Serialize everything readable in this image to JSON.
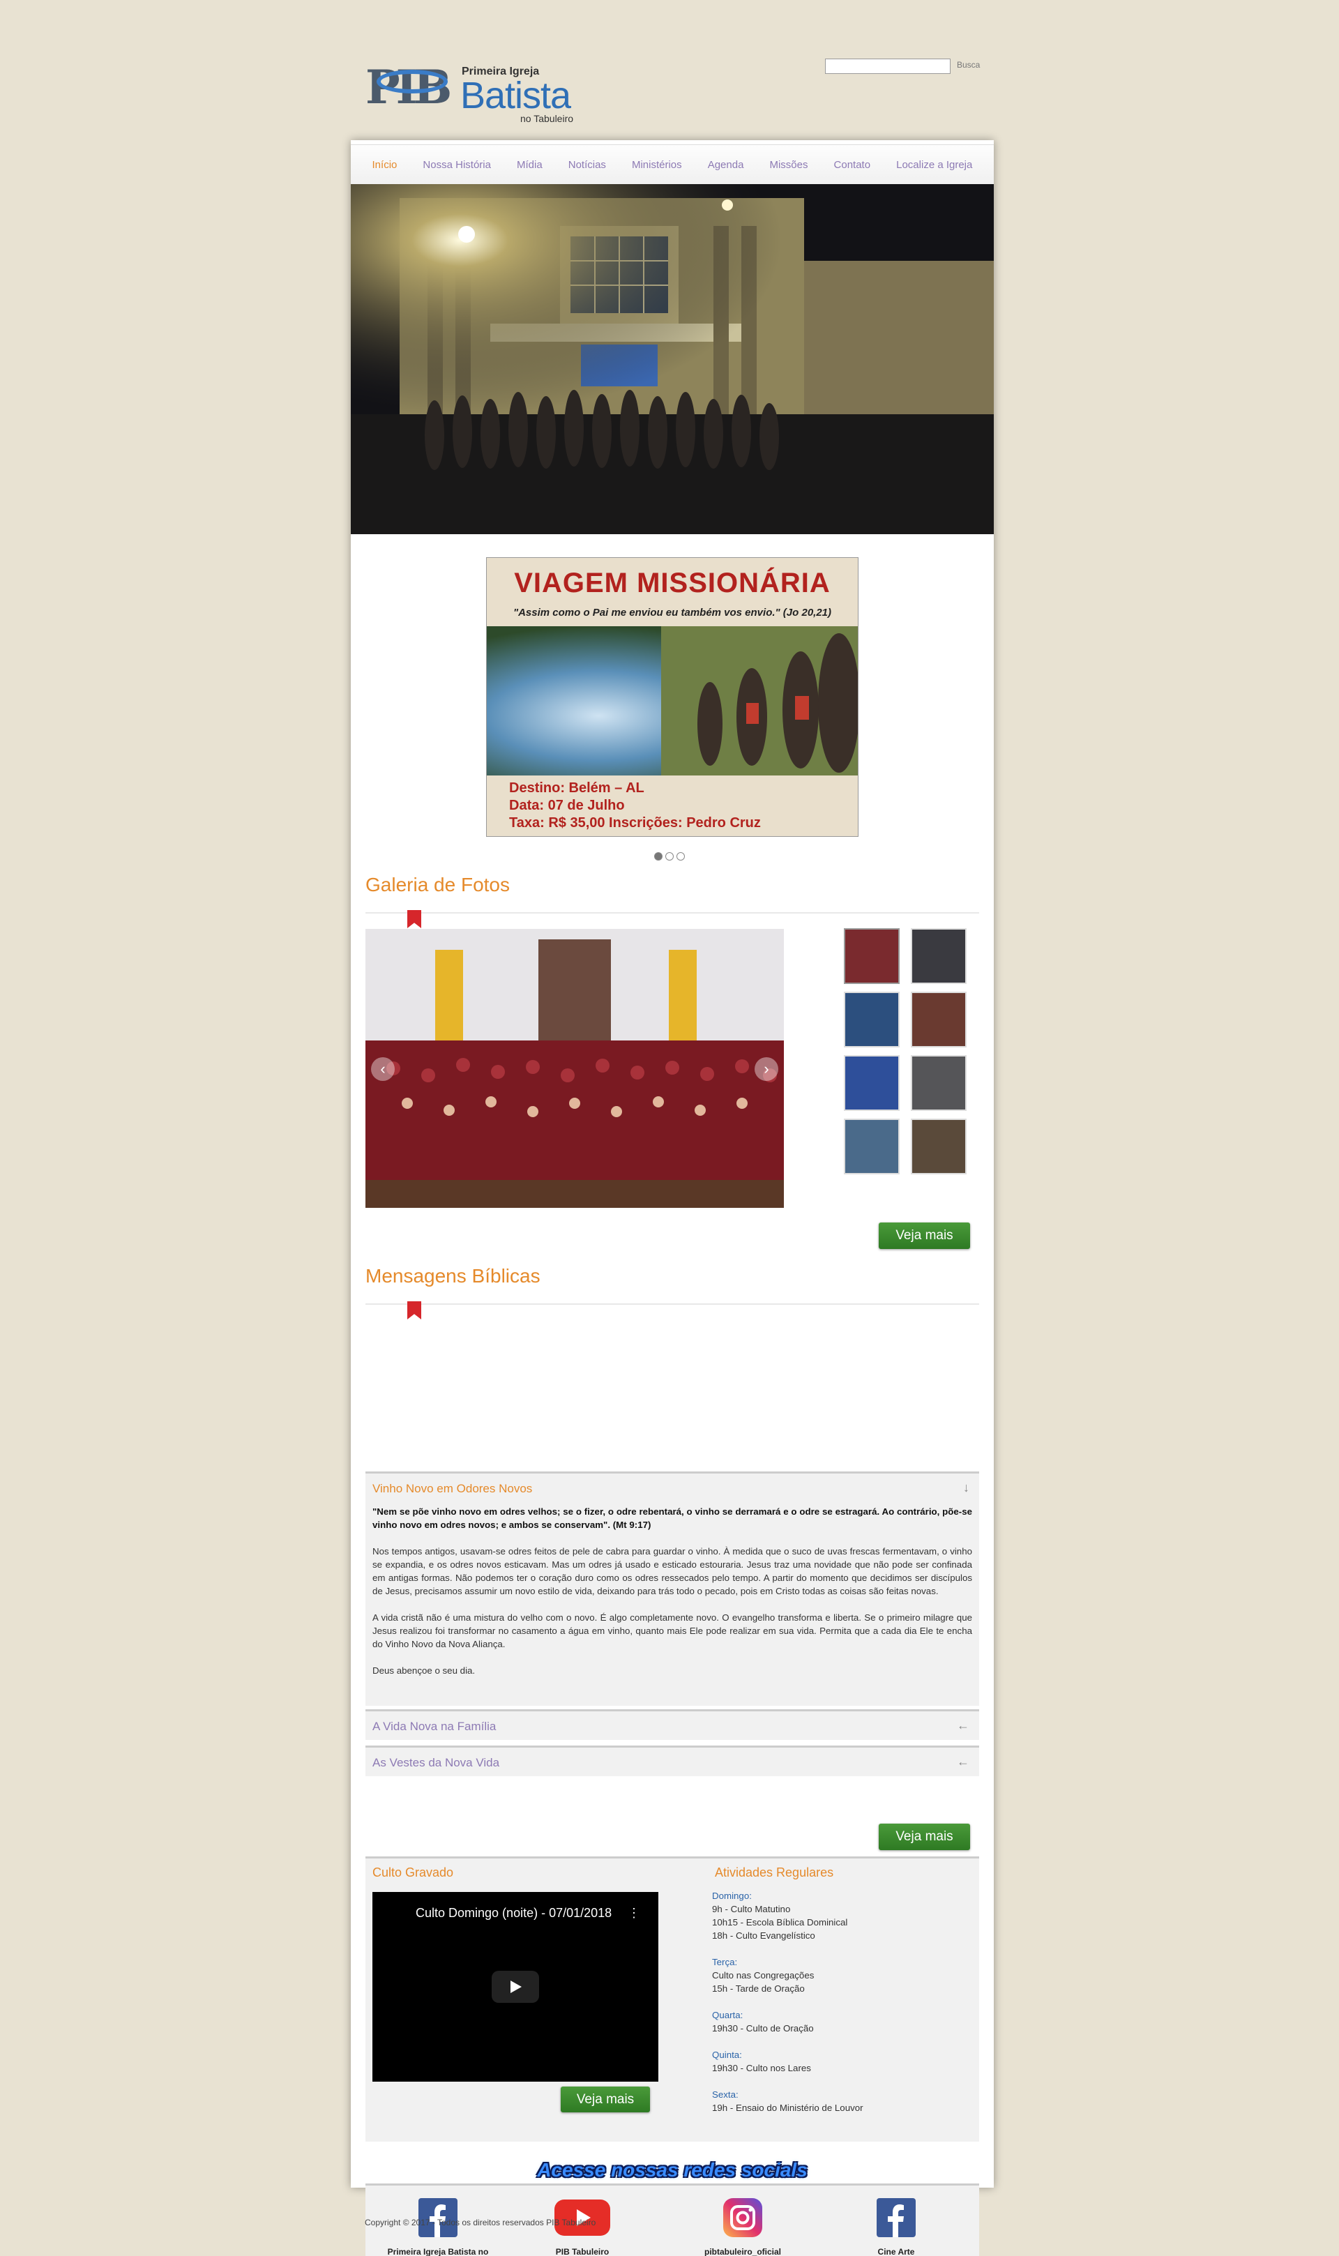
{
  "header": {
    "logo_mark": "PIB",
    "logo_line1": "Primeira Igreja",
    "logo_line2": "Batista",
    "logo_line3": "no Tabuleiro",
    "search_button": "Busca"
  },
  "nav": [
    {
      "label": "Início"
    },
    {
      "label": "Nossa História"
    },
    {
      "label": "Mídia"
    },
    {
      "label": "Notícias"
    },
    {
      "label": "Ministérios"
    },
    {
      "label": "Agenda"
    },
    {
      "label": "Missões"
    },
    {
      "label": "Contato"
    },
    {
      "label": "Localize a Igreja"
    }
  ],
  "banner": {
    "title": "VIAGEM MISSIONÁRIA",
    "verse": "\"Assim como o Pai me enviou eu também vos envio.\" (Jo 20,21)",
    "line1": "Destino: Belém – AL",
    "line2": "Data: 07 de Julho",
    "line3": "Taxa: R$ 35,00    Inscrições: Pedro Cruz"
  },
  "gallery": {
    "title": "Galeria de Fotos",
    "more_button": "Veja mais"
  },
  "messages": {
    "title": "Mensagens Bíblicas",
    "items": [
      {
        "label": "Vinho Novo em Odores Novos"
      },
      {
        "label": "A Vida Nova na Família"
      },
      {
        "label": "As Vestes da Nova Vida"
      }
    ],
    "body": {
      "lead": "\"Nem se põe vinho novo em odres velhos; se o fizer, o odre rebentará, o vinho se derramará e o odre se estragará. Ao contrário, põe-se vinho novo em odres novos; e ambos se conservam\". (Mt 9:17)",
      "p1": "Nos tempos antigos, usavam-se odres feitos de pele de cabra para guardar o vinho. À medida que o suco de uvas frescas fermentavam, o vinho se expandia, e os odres novos esticavam. Mas um odres já usado e esticado estouraria. Jesus traz uma novidade que não pode ser confinada em antigas formas. Não podemos ter o coração duro como os odres ressecados pelo tempo. A partir do momento que decidimos ser discípulos de Jesus, precisamos assumir um novo estilo de vida, deixando para trás todo o pecado, pois em Cristo todas as coisas são feitas novas.",
      "p2": "A vida cristã não é uma mistura do velho com o novo. É algo completamente novo. O evangelho transforma e liberta. Se o primeiro milagre que Jesus realizou foi transformar no casamento a água em vinho, quanto mais Ele pode realizar em sua vida. Permita que a cada dia Ele te encha do Vinho Novo da Nova Aliança.",
      "p3": "Deus abençoe o seu dia."
    },
    "more_button": "Veja mais"
  },
  "culto": {
    "title": "Culto Gravado",
    "video_title": "Culto Domingo (noite) - 07/01/2018",
    "more_button": "Veja mais"
  },
  "activities": {
    "title": "Atividades Regulares",
    "days": [
      {
        "day": "Domingo:",
        "items": [
          "9h - Culto Matutino",
          "10h15 - Escola Bíblica Dominical",
          "18h - Culto Evangelístico"
        ]
      },
      {
        "day": "Terça:",
        "items": [
          "Culto nas Congregações",
          "15h - Tarde de Oração"
        ]
      },
      {
        "day": "Quarta:",
        "items": [
          "19h30 - Culto de Oração"
        ]
      },
      {
        "day": "Quinta:",
        "items": [
          "19h30 - Culto nos Lares"
        ]
      },
      {
        "day": "Sexta:",
        "items": [
          "19h - Ensaio do Ministério de Louvor"
        ]
      }
    ]
  },
  "social": {
    "title": "Acesse nossas redes socials",
    "links": [
      {
        "label": "Primeira Igreja Batista no Tabuleiro - OFICIAL",
        "icon": "facebook-icon"
      },
      {
        "label": "PIB Tabuleiro",
        "icon": "youtube-icon"
      },
      {
        "label": "pibtabuleiro_oficial",
        "icon": "instagram-icon"
      },
      {
        "label": "Cine Arte",
        "icon": "facebook-icon"
      }
    ]
  },
  "footer": {
    "copyright": "Copyright © 2017 - Todos os direitos reservados PIB Tabuleiro"
  },
  "colors": {
    "background": "#e8e2d2",
    "accent_orange": "#e58a2b",
    "nav_purple": "#8d7ab4",
    "button_green": "#3a8a2e",
    "banner_red": "#b2221e"
  }
}
